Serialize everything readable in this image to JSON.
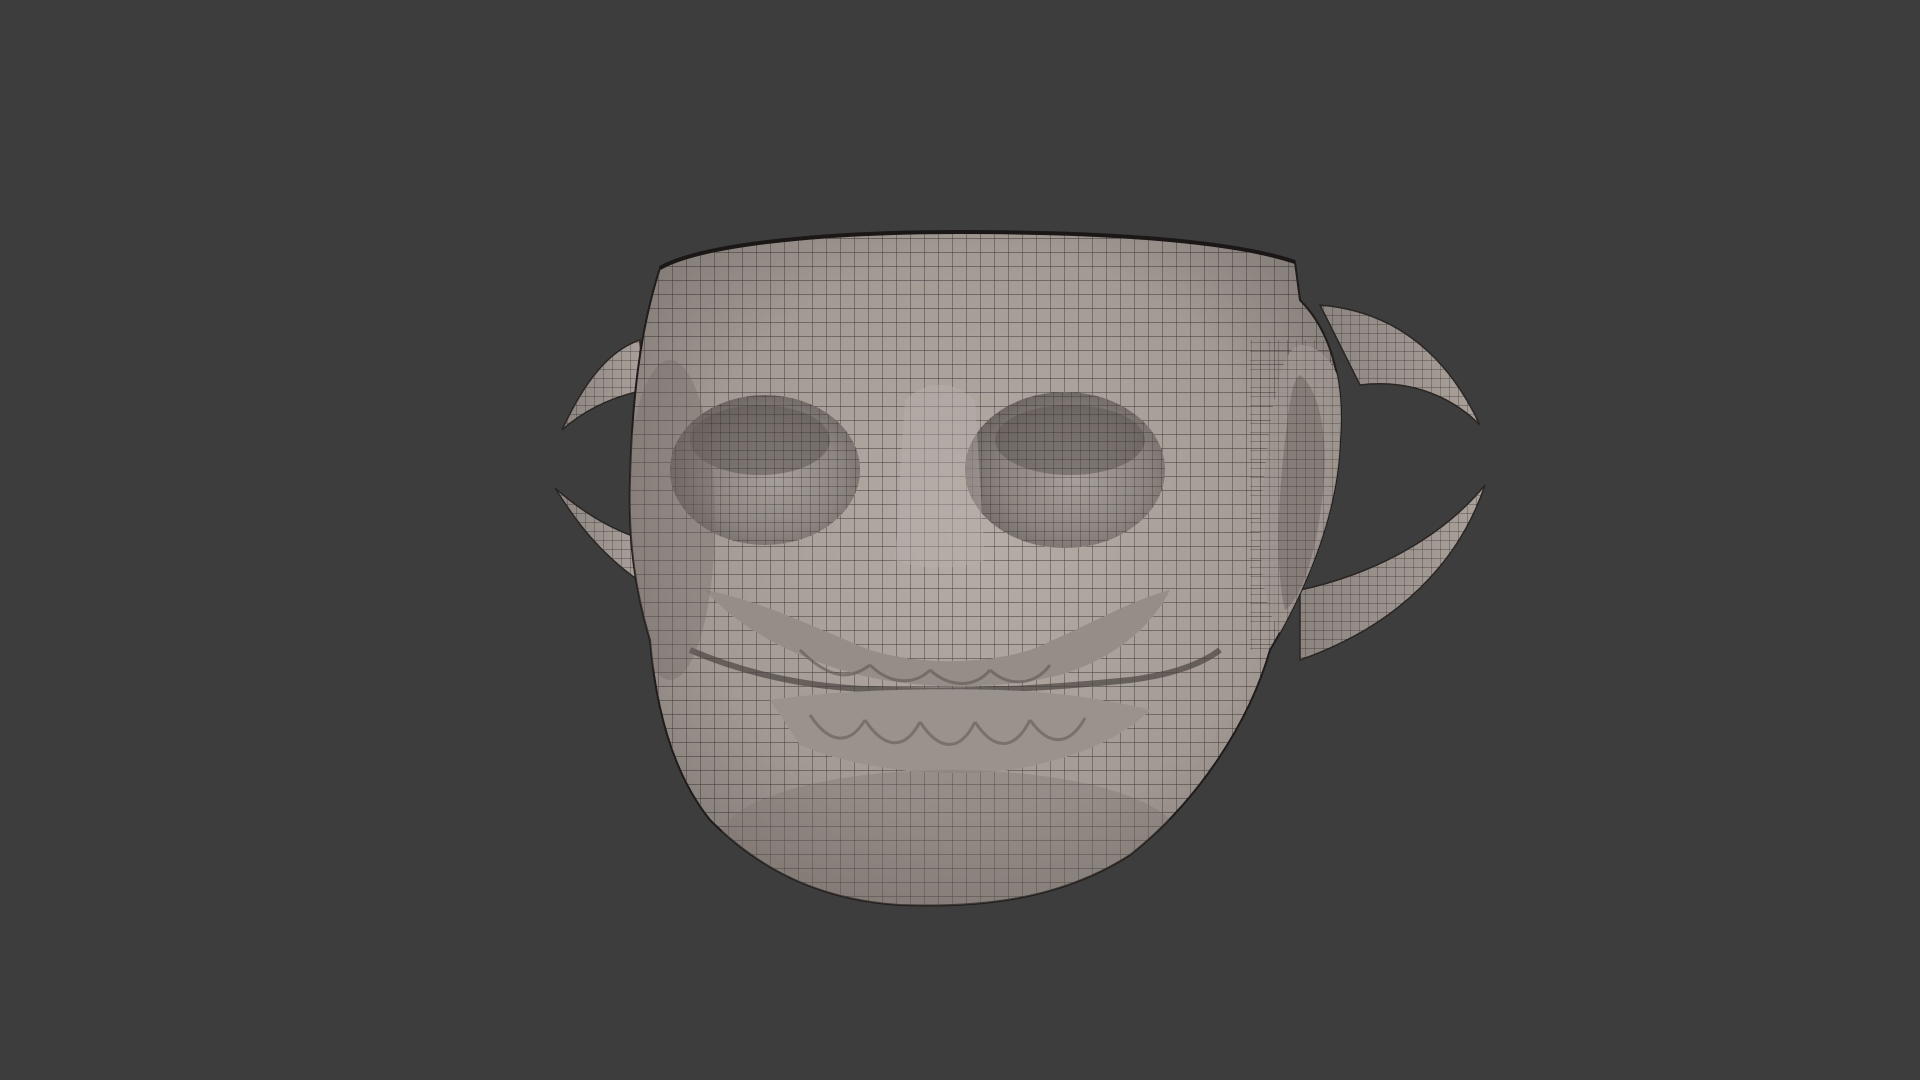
{
  "viewport": {
    "background_color": "#3d3d3d",
    "model": {
      "icon": "skull-mask-mesh",
      "surface_color": "#a79e98",
      "shadow_color": "#6f6863",
      "wire_color": "#1f1c1b",
      "spike_color": "#9c938d"
    }
  }
}
